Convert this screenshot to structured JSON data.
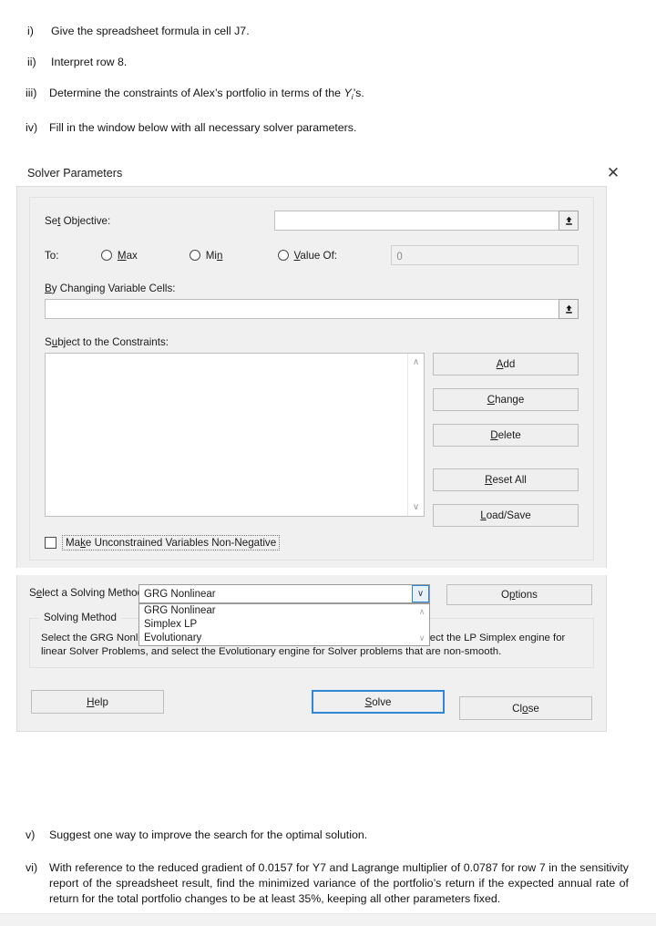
{
  "top_questions": [
    {
      "num": "i)",
      "text": "Give the spreadsheet formula in cell J7."
    },
    {
      "num": "ii)",
      "text": "Interpret row 8."
    },
    {
      "num": "iii)",
      "text_before": "Determine the constraints of Alex’s portfolio in terms of the ",
      "var": "Y",
      "var_sub": "i",
      "text_after": "’s."
    },
    {
      "num": "iv)",
      "text": "Fill in the window below with all necessary solver parameters."
    }
  ],
  "dialog": {
    "title": "Solver Parameters",
    "close_icon": "✕",
    "set_objective": {
      "label_pre": "Se",
      "label_accel": "t",
      "label_post": " Objective:",
      "value": "",
      "picker_icon": "range-picker"
    },
    "to": {
      "label": "To:",
      "options": [
        {
          "pre": "",
          "accel": "M",
          "post": "ax",
          "selected": false
        },
        {
          "pre": "Mi",
          "accel": "n",
          "post": "",
          "selected": false
        },
        {
          "pre": "",
          "accel": "V",
          "post": "alue Of:",
          "selected": false
        }
      ],
      "value_of_value": "0"
    },
    "changing_cells": {
      "label_pre": "",
      "label_accel": "B",
      "label_post": "y Changing Variable Cells:",
      "value": "",
      "picker_icon": "range-picker"
    },
    "constraints": {
      "label_pre": "S",
      "label_accel": "u",
      "label_post": "bject to the Constraints:",
      "items": [],
      "scroll_up_icon": "∧",
      "scroll_down_icon": "∨"
    },
    "constraint_buttons": [
      {
        "pre": "",
        "accel": "A",
        "post": "dd"
      },
      {
        "pre": "",
        "accel": "C",
        "post": "hange"
      },
      {
        "pre": "",
        "accel": "D",
        "post": "elete"
      },
      {
        "pre": "",
        "accel": "R",
        "post": "eset All"
      },
      {
        "pre": "",
        "accel": "L",
        "post": "oad/Save"
      }
    ],
    "unconstrained_checkbox": {
      "pre": "Ma",
      "accel": "k",
      "post": "e Unconstrained Variables Non-Negative",
      "checked": false
    },
    "solving_method": {
      "label_pre": "S",
      "label_accel": "e",
      "label_post": "lect a Solving Method:",
      "selected": "GRG Nonlinear",
      "options": [
        "GRG Nonlinear",
        "Simplex LP",
        "Evolutionary"
      ],
      "arrow_icon": "∨",
      "list_up_icon": "∧",
      "list_down_icon": "∨"
    },
    "options_button": {
      "pre": "O",
      "accel": "p",
      "post": "tions"
    },
    "solving_method_group": {
      "legend_pre": "Solvin",
      "legend_accel": "g",
      "legend_post": " Method",
      "description": "Select the GRG Nonlinear engine for Solver Problems that are smooth nonlinear. Select the LP Simplex engine for linear Solver Problems, and select the Evolutionary engine for Solver problems that are non-smooth."
    },
    "footer_buttons": [
      {
        "pre": "",
        "accel": "H",
        "post": "elp",
        "primary": false
      },
      {
        "pre": "",
        "accel": "S",
        "post": "olve",
        "primary": true
      },
      {
        "pre": "Cl",
        "accel": "o",
        "post": "se",
        "primary": false
      }
    ]
  },
  "bottom_questions": [
    {
      "num": "v)",
      "text": "Suggest one way to improve the search for the optimal solution."
    },
    {
      "num": "vi)",
      "text": "With reference to the reduced gradient of 0.0157 for Y7 and Lagrange multiplier of 0.0787 for row 7 in the sensitivity report of the spreadsheet result, find the minimized variance of the portfolio’s return if the expected annual rate of return for the total portfolio changes to be at least 35%, keeping all other parameters fixed."
    }
  ]
}
